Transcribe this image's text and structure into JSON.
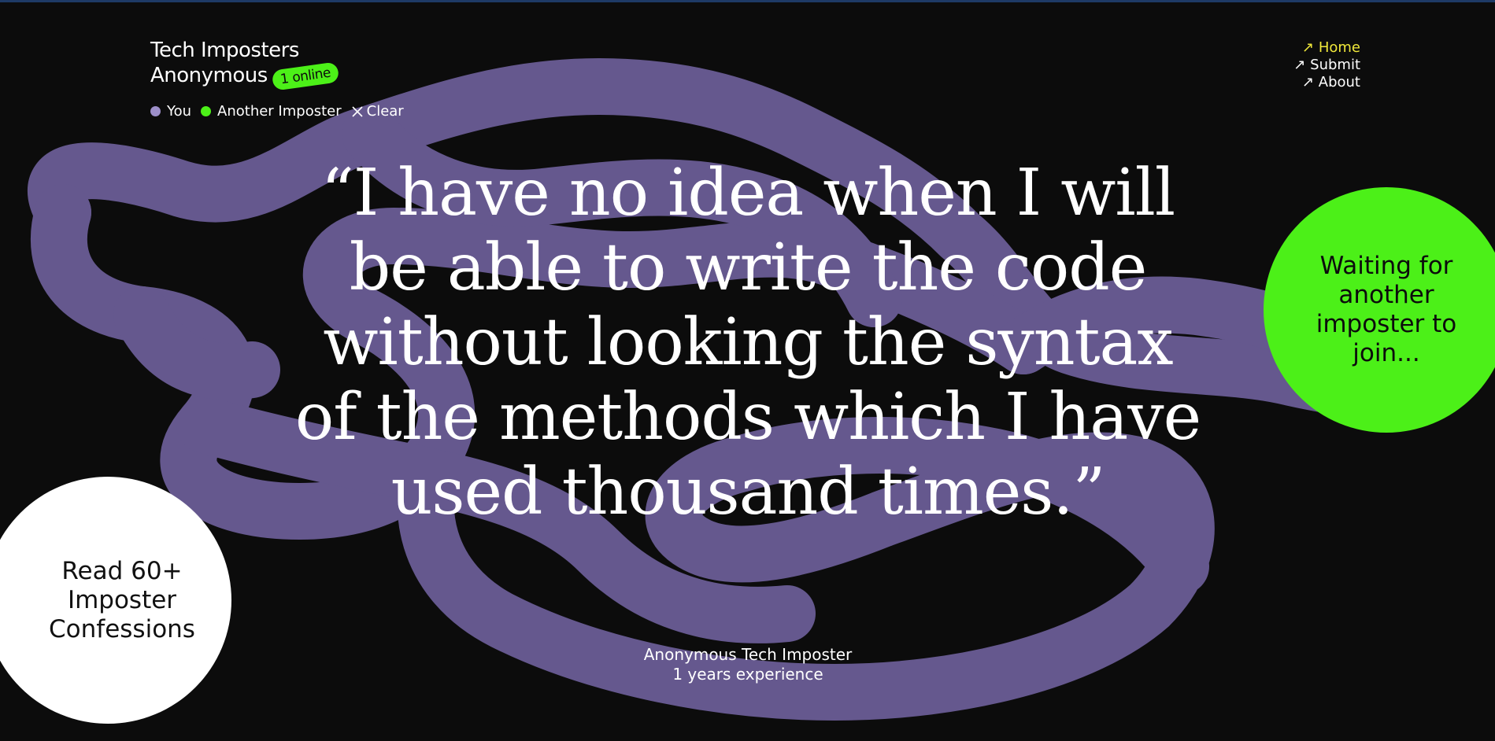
{
  "brand": {
    "title_line1": "Tech Imposters",
    "title_line2": "Anonymous",
    "online_badge": "1 online"
  },
  "legend": {
    "you_label": "You",
    "other_label": "Another Imposter",
    "clear_label": "Clear",
    "you_color": "#9d8fc9",
    "other_color": "#4cf018"
  },
  "nav": {
    "items": [
      {
        "label": "↗ Home",
        "active": true
      },
      {
        "label": "↗ Submit",
        "active": false
      },
      {
        "label": "↗ About",
        "active": false
      }
    ]
  },
  "quote": {
    "text": "“I have no idea when I will be able to write the code without looking the syntax of the methods which I have used thousand times.”"
  },
  "attribution": {
    "name": "Anonymous Tech Imposter",
    "experience": "1 years experience"
  },
  "waiting_circle": {
    "text": "Waiting for another imposter to join..."
  },
  "read_circle": {
    "text": "Read 60+ Imposter Confessions"
  },
  "colors": {
    "background": "#0c0c0c",
    "accent_green": "#4cf018",
    "scribble_purple": "#6a5d96",
    "active_nav": "#f0e83a"
  }
}
